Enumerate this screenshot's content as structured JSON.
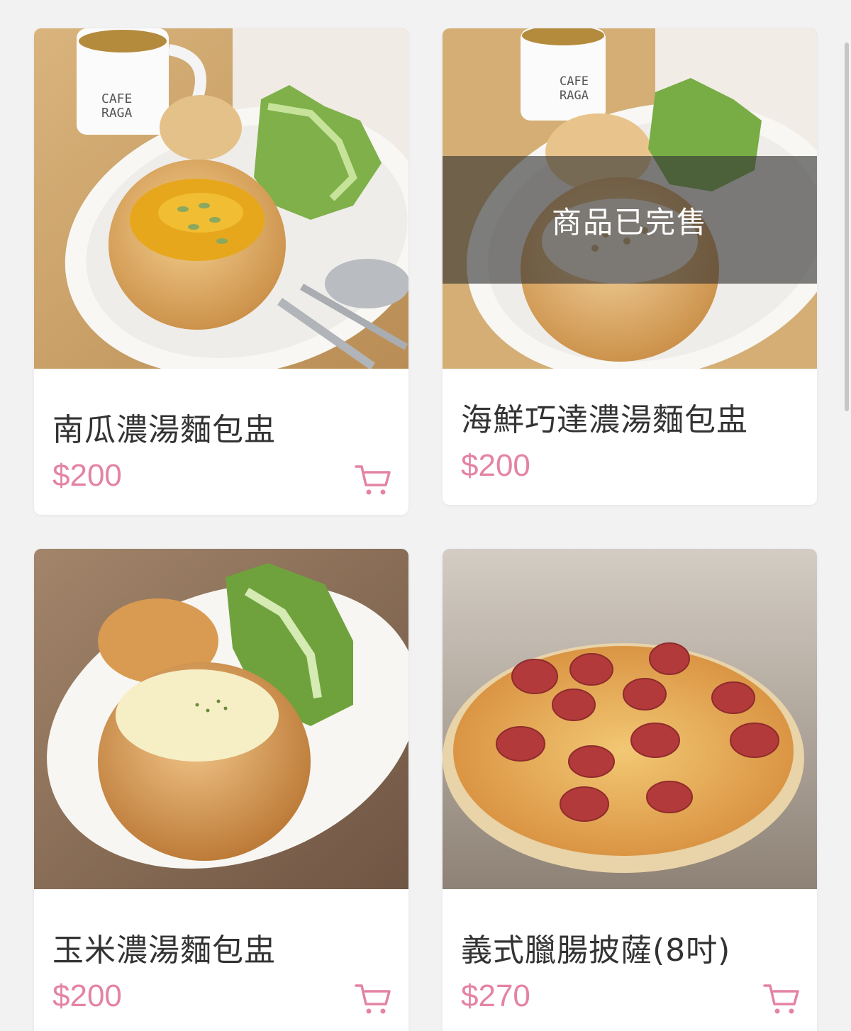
{
  "products": [
    {
      "name": "南瓜濃湯麵包盅",
      "price": "$200",
      "image": "pumpkin-soup-bread-bowl",
      "sold_out": false
    },
    {
      "name": "海鮮巧達濃湯麵包盅",
      "price": "$200",
      "image": "seafood-chowder-bread-bowl",
      "sold_out": true,
      "sold_out_label": "商品已完售"
    },
    {
      "name": "玉米濃湯麵包盅",
      "price": "$200",
      "image": "corn-soup-bread-bowl",
      "sold_out": false
    },
    {
      "name": "義式臘腸披薩(8吋)",
      "price": "$270",
      "image": "pepperoni-pizza",
      "sold_out": false
    }
  ],
  "icons": {
    "cart": "cart-icon"
  },
  "colors": {
    "price": "#e483a3",
    "cart": "#e483a3",
    "background": "#f2f2f3",
    "sold_out_overlay": "#323232"
  }
}
